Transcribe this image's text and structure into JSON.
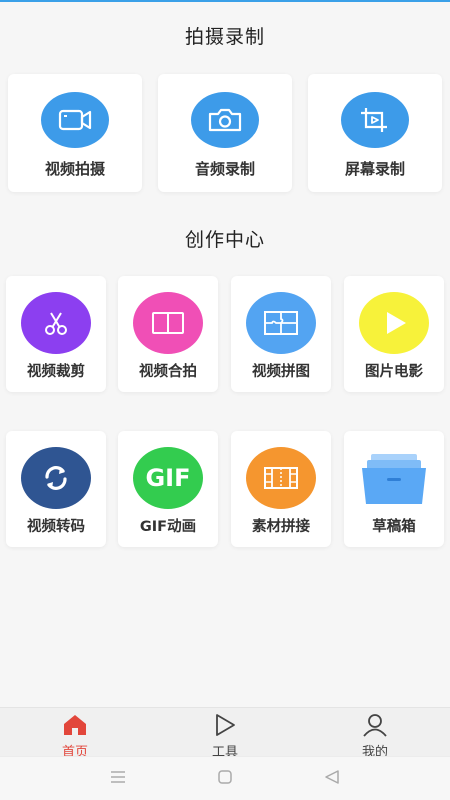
{
  "sections": {
    "capture_title": "拍摄录制",
    "create_title": "创作中心"
  },
  "capture_items": [
    {
      "label": "视频拍摄",
      "icon": "video-camera-icon"
    },
    {
      "label": "音频录制",
      "icon": "camera-icon"
    },
    {
      "label": "屏幕录制",
      "icon": "screen-record-icon"
    }
  ],
  "create_items": [
    {
      "label": "视频裁剪",
      "icon": "scissors-icon",
      "color": "#8c3ff0"
    },
    {
      "label": "视频合拍",
      "icon": "split-frame-icon",
      "color": "#f04fb6"
    },
    {
      "label": "视频拼图",
      "icon": "puzzle-icon",
      "color": "#53a4f2"
    },
    {
      "label": "图片电影",
      "icon": "play-icon",
      "color": "#f7f23a"
    },
    {
      "label": "视频转码",
      "icon": "convert-arrows-icon",
      "color": "#2f5592"
    },
    {
      "label": "GIF动画",
      "icon": "gif-icon",
      "color": "#33cc4f",
      "icon_text": "GIF"
    },
    {
      "label": "素材拼接",
      "icon": "film-strip-icon",
      "color": "#f5962f"
    },
    {
      "label": "草稿箱",
      "icon": "drafts-box-icon",
      "color": "#5aa8f5"
    }
  ],
  "nav": [
    {
      "label": "首页",
      "icon": "home-icon",
      "active": true
    },
    {
      "label": "工具",
      "icon": "play-outline-icon",
      "active": false
    },
    {
      "label": "我的",
      "icon": "user-icon",
      "active": false
    }
  ],
  "colors": {
    "accent": "#e2463b",
    "primary_blue": "#3d9be9"
  }
}
